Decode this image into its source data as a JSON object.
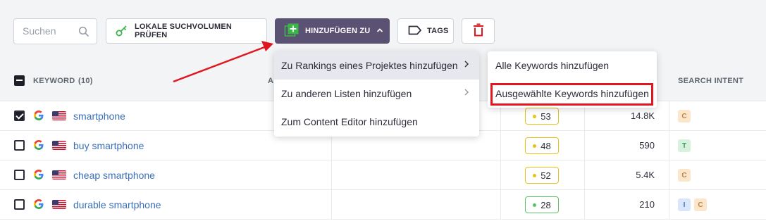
{
  "toolbar": {
    "search_placeholder": "Suchen",
    "lokale_label": "LOKALE SUCHVOLUMEN PRÜFEN",
    "hinzufuegen_label": "HINZUFÜGEN ZU",
    "tags_label": "TAGS",
    "accent_color": "#5a5173",
    "delete_color": "#e0171f"
  },
  "table": {
    "header": {
      "keyword": "KEYWORD",
      "count": "(10)",
      "col_a": "A",
      "search_intent": "SEARCH INTENT"
    },
    "rows": [
      {
        "keyword": "smartphone",
        "checked": true,
        "kd": "53",
        "kd_color": "#e8c21a",
        "volume": "14.8K",
        "intents": [
          "C"
        ]
      },
      {
        "keyword": "buy smartphone",
        "checked": false,
        "kd": "48",
        "kd_color": "#e8c21a",
        "volume": "590",
        "intents": [
          "T"
        ]
      },
      {
        "keyword": "cheap smartphone",
        "checked": false,
        "kd": "52",
        "kd_color": "#e8c21a",
        "volume": "5.4K",
        "intents": [
          "C"
        ]
      },
      {
        "keyword": "durable smartphone",
        "checked": false,
        "kd": "28",
        "kd_color": "#5cc36a",
        "volume": "210",
        "intents": [
          "I",
          "C"
        ]
      }
    ]
  },
  "menu": {
    "items": [
      {
        "label": "Zu Rankings eines Projektes hinzufügen",
        "has_submenu": true,
        "active": true
      },
      {
        "label": "Zu anderen Listen hinzufügen",
        "has_submenu": true,
        "active": false
      },
      {
        "label": "Zum Content Editor hinzufügen",
        "has_submenu": false,
        "active": false
      }
    ],
    "submenu": [
      {
        "label": "Alle Keywords hinzufügen"
      },
      {
        "label": "Ausgewählte Keywords hinzufügen",
        "highlighted": true
      }
    ]
  }
}
